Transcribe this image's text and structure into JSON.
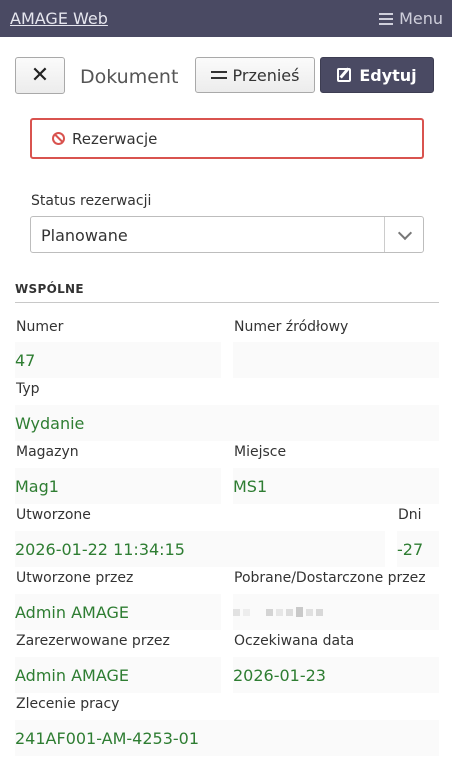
{
  "app": {
    "brand": "AMAGE Web",
    "menu_label": "Menu"
  },
  "toolbar": {
    "close_symbol": "✕",
    "title": "Dokument",
    "move_label": "Przenieś",
    "edit_label": "Edytuj"
  },
  "alert": {
    "label": "Rezerwacje",
    "color": "#d9534f"
  },
  "status": {
    "label": "Status rezerwacji",
    "value": "Planowane"
  },
  "section": {
    "title": "WSPÓLNE"
  },
  "fields": {
    "numer": {
      "label": "Numer",
      "value": "47"
    },
    "numer_zrodlowy": {
      "label": "Numer źródłowy",
      "value": ""
    },
    "typ": {
      "label": "Typ",
      "value": "Wydanie"
    },
    "magazyn": {
      "label": "Magazyn",
      "value": "Mag1"
    },
    "miejsce": {
      "label": "Miejsce",
      "value": "MS1"
    },
    "utworzone": {
      "label": "Utworzone",
      "value": "2026-01-22 11:34:15"
    },
    "dni": {
      "label": "Dni",
      "value": "-27"
    },
    "utworzone_przez": {
      "label": "Utworzone przez",
      "value": "Admin AMAGE"
    },
    "pobrane": {
      "label": "Pobrane/Dostarczone przez",
      "value": ""
    },
    "zarezerwowane": {
      "label": "Zarezerwowane przez",
      "value": "Admin AMAGE"
    },
    "oczekiwana": {
      "label": "Oczekiwana data",
      "value": "2026-01-23"
    },
    "zlecenie": {
      "label": "Zlecenie pracy",
      "value": "241AF001-AM-4253-01"
    }
  },
  "colors": {
    "topbar": "#4a4a63",
    "value_text": "#2e7d32",
    "primary_button": "#4a4a63"
  }
}
